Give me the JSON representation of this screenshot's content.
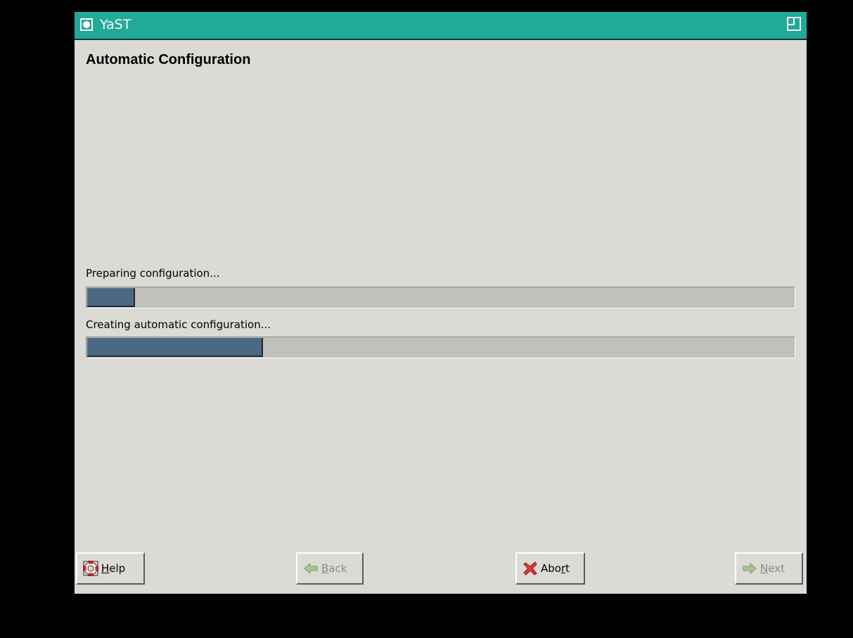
{
  "window": {
    "title": "YaST"
  },
  "page": {
    "heading": "Automatic Configuration"
  },
  "steps": [
    {
      "label": "Preparing configuration...",
      "progress": 0.07
    },
    {
      "label": "Creating automatic configuration...",
      "progress": 0.25
    }
  ],
  "buttons": {
    "help": {
      "accel": "H",
      "rest": "elp",
      "icon": "lifebuoy-icon",
      "enabled": true
    },
    "back": {
      "accel": "B",
      "rest": "ack",
      "icon": "back-arrow-icon",
      "enabled": false
    },
    "abort": {
      "pre": "Abo",
      "accel": "r",
      "rest": "t",
      "icon": "abort-x-icon",
      "enabled": true
    },
    "next": {
      "accel": "N",
      "rest": "ext",
      "icon": "next-arrow-icon",
      "enabled": false
    }
  },
  "colors": {
    "titlebar": "#20ab98",
    "progress_fill": "#4b6983",
    "window_bg": "#dcdad5"
  }
}
